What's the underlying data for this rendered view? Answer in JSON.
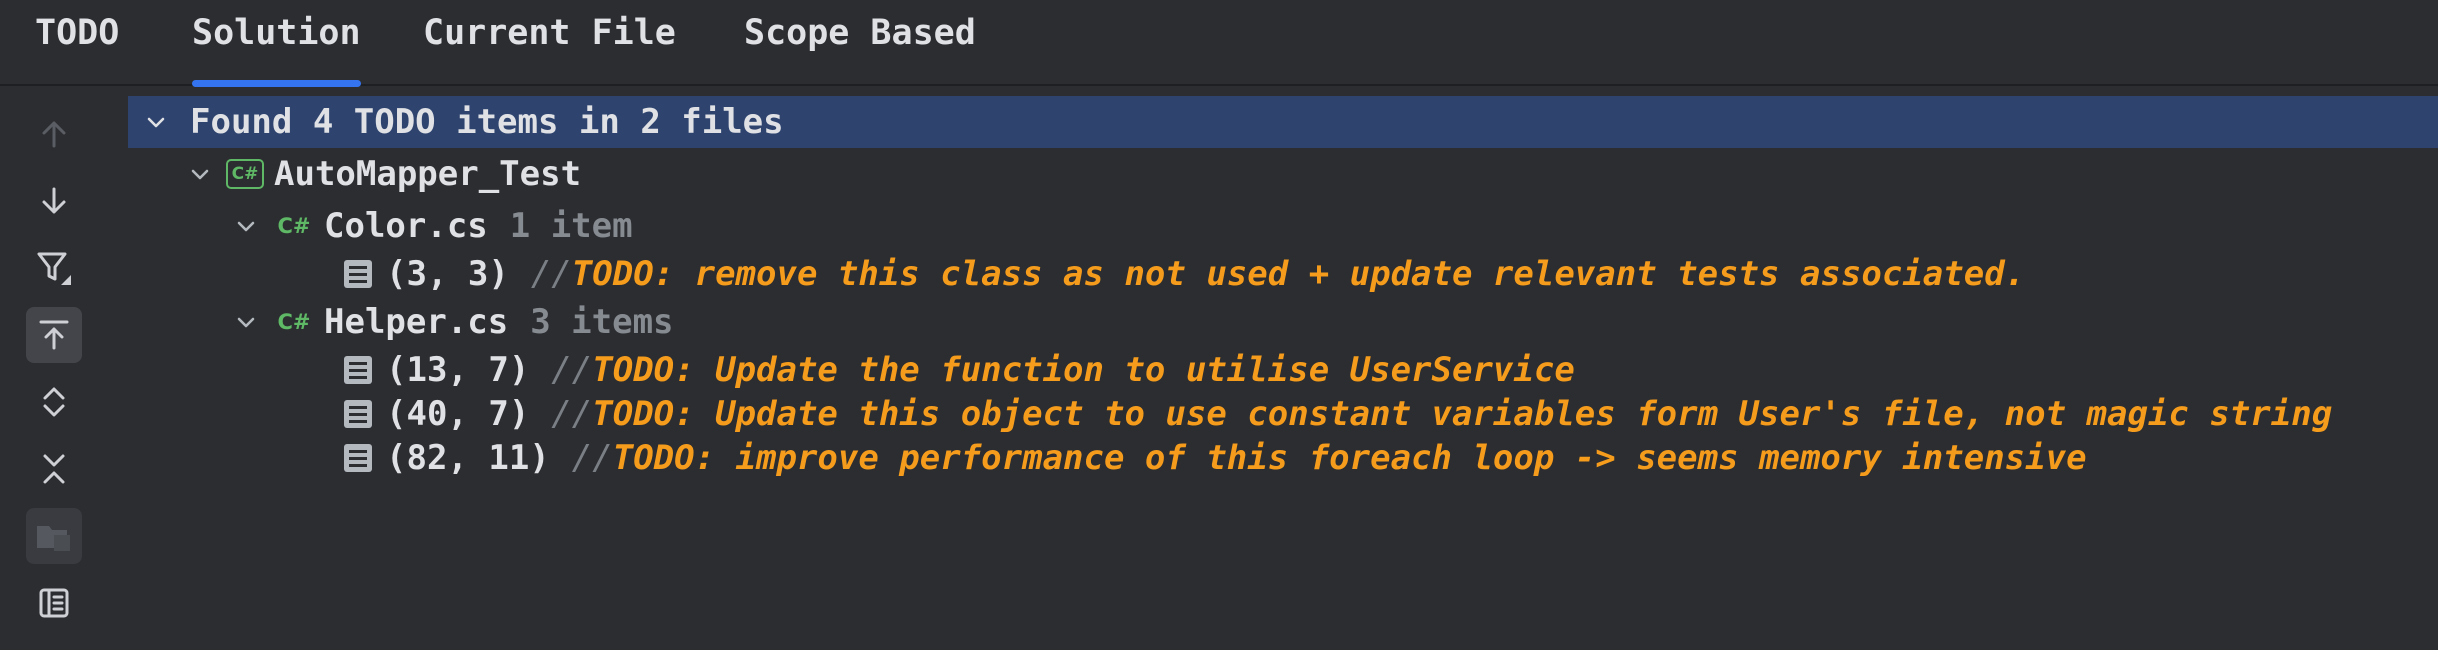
{
  "tabs": [
    {
      "label": "TODO",
      "active": false
    },
    {
      "label": "Solution",
      "active": true
    },
    {
      "label": "Current File",
      "active": false
    },
    {
      "label": "Scope Based",
      "active": false
    }
  ],
  "toolbar": {
    "icons": [
      "arrow-up-icon",
      "arrow-down-icon",
      "filter-icon",
      "autoscroll-icon",
      "expand-all-icon",
      "collapse-all-icon",
      "group-by-module-icon",
      "preview-panel-icon"
    ]
  },
  "tree": {
    "summary": "Found 4 TODO items in 2 files",
    "project": {
      "icon_label": "C#",
      "name": "AutoMapper_Test"
    },
    "files": [
      {
        "icon_label": "C#",
        "name": "Color.cs",
        "count": "1 item",
        "items": [
          {
            "pos": "(3, 3)",
            "comment_prefix": "//",
            "text": "TODO: remove this class as not used + update relevant tests associated."
          }
        ]
      },
      {
        "icon_label": "C#",
        "name": "Helper.cs",
        "count": "3 items",
        "items": [
          {
            "pos": "(13, 7)",
            "comment_prefix": "//",
            "text": "TODO: Update the function to utilise UserService"
          },
          {
            "pos": "(40, 7)",
            "comment_prefix": "//",
            "text": "TODO: Update this object to use constant variables form User's file, not magic string"
          },
          {
            "pos": "(82, 11)",
            "comment_prefix": "//",
            "text": "TODO: improve performance of this foreach loop -> seems memory intensive"
          }
        ]
      }
    ]
  },
  "colors": {
    "background": "#2b2d30",
    "selection": "#2e436e",
    "accent": "#3574f0",
    "todo": "#f59c1d",
    "csharp": "#5fb865"
  }
}
